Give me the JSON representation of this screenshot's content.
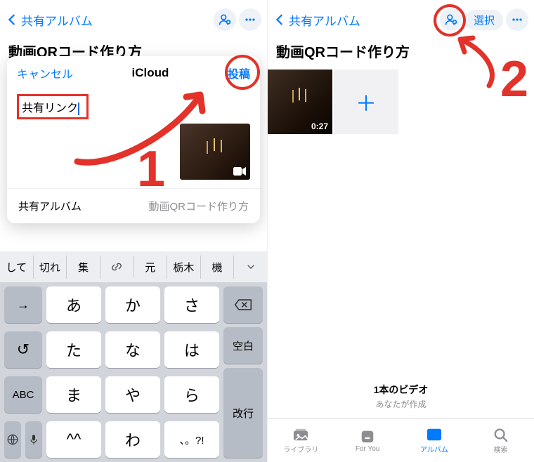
{
  "colors": {
    "accent": "#007aff",
    "annotation": "#e2322a"
  },
  "left": {
    "back_label": "共有アルバム",
    "page_title": "動画QRコード作り方",
    "modal": {
      "cancel": "キャンセル",
      "title": "iCloud",
      "post": "投稿",
      "input_value": "共有リンク",
      "footer_left": "共有アルバム",
      "footer_right": "動画QRコード作り方"
    },
    "predictions": [
      "して",
      "切れ",
      "集",
      "元",
      "栃木",
      "機"
    ],
    "keyboard": {
      "rows": [
        [
          "→",
          "あ",
          "か",
          "さ"
        ],
        [
          "↺",
          "た",
          "な",
          "は",
          "空白"
        ],
        [
          "ABC",
          "ま",
          "や",
          "ら"
        ],
        [
          "😀",
          "🎤",
          "^^",
          "わ",
          "、。?!"
        ]
      ],
      "backspace": "⌫",
      "enter": "改行"
    },
    "annotation_num": "1"
  },
  "right": {
    "back_label": "共有アルバム",
    "select": "選択",
    "page_title": "動画QRコード作り方",
    "video_duration": "0:27",
    "add": "＋",
    "footer": {
      "line1": "1本のビデオ",
      "line2": "あなたが作成"
    },
    "tabs": [
      "ライブラリ",
      "For You",
      "アルバム",
      "検索"
    ],
    "active_tab_index": 2,
    "annotation_num": "2"
  }
}
